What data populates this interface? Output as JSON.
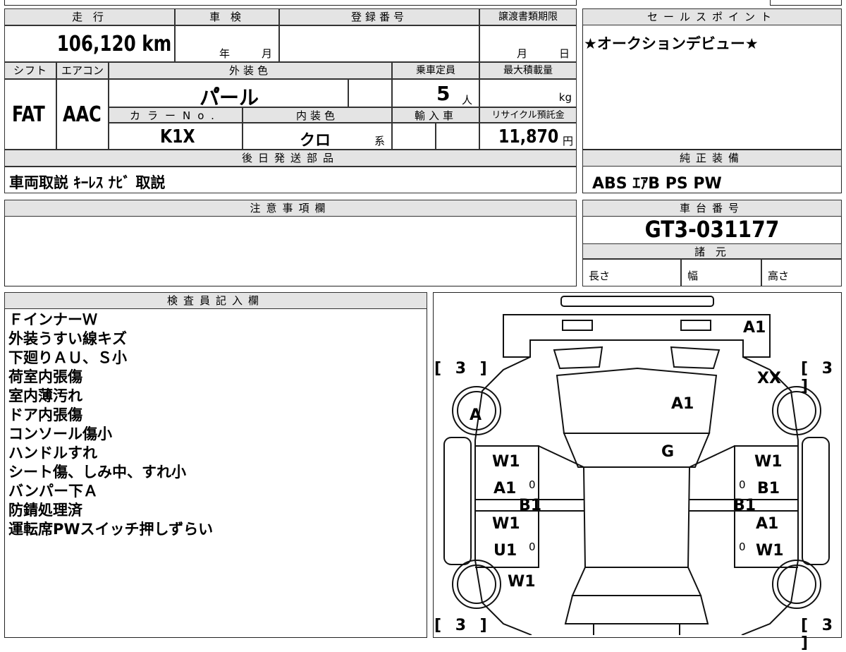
{
  "mileage": {
    "header": "走 行",
    "value": "106,120 km"
  },
  "inspection": {
    "header": "車 検",
    "year_unit": "年",
    "month_unit": "月"
  },
  "registration": {
    "header": "登録番号"
  },
  "transfer_deadline": {
    "header": "譲渡書類期限",
    "month_unit": "月",
    "day_unit": "日"
  },
  "sales_point": {
    "header": "セールスポイント",
    "text": "★オークションデビュー★"
  },
  "shift": {
    "header": "シフト",
    "value": "FAT"
  },
  "aircon": {
    "header": "エアコン",
    "value": "AAC"
  },
  "exterior_color": {
    "header": "外装色",
    "value": "パ゚ール"
  },
  "capacity": {
    "header": "乗車定員",
    "value": "5",
    "unit": "人"
  },
  "max_load": {
    "header": "最大積載量",
    "unit": "kg"
  },
  "color_no": {
    "header": "カラーNo.",
    "value": "K1X"
  },
  "interior_color": {
    "header": "内装色",
    "value": "クロ",
    "suffix": "系"
  },
  "import": {
    "header": "輸入車"
  },
  "recycle_fee": {
    "header": "リサイクル預託金",
    "value": "11,870",
    "unit": "円"
  },
  "later_parts": {
    "header": "後日発送部品",
    "text": "車両取説 ｷｰﾚｽ ﾅﾋﾞ 取説"
  },
  "genuine_equipment": {
    "header": "純正装備",
    "text": "ABS ｴｱB PS PW"
  },
  "notes": {
    "header": "注意事項欄"
  },
  "chassis": {
    "header": "車台番号",
    "value": "GT3-031177"
  },
  "specs": {
    "header": "諸 元",
    "length": "長さ",
    "width": "幅",
    "height": "高さ"
  },
  "inspector": {
    "header": "検査員記入欄",
    "lines": [
      "ＦインナーＷ",
      "外装うすい線キズ",
      "下廻りＡＵ、Ｓ小",
      "荷室内張傷",
      "室内薄汚れ",
      "ドア内張傷",
      "コンソール傷小",
      "ハンドルすれ",
      "シート傷、しみ中、すれ小",
      "バンパー下Ａ",
      "防錆処理済",
      "運転席PWスイッチ押しずらい"
    ]
  },
  "diagram": {
    "marks": {
      "front_bumper": "A1",
      "front_right": "XX",
      "hood": "A1",
      "windshield": "G",
      "left_wheel_front": "A",
      "l_fender_top": "W1",
      "l_fender_mid": "A1",
      "l_sill": "B1",
      "l_rdoor_top": "W1",
      "l_rdoor_mid": "U1",
      "l_rear": "W1",
      "r_fender_top": "W1",
      "r_fender_mid": "B1",
      "r_sill": "B1",
      "r_rdoor_top": "A1",
      "r_rdoor_mid": "W1",
      "small_0": "0"
    },
    "tire_marks": {
      "tl": "[ 3 ]",
      "tr": "[ 3 ]",
      "bl": "[ 3 ]",
      "br": "[ 3 ]"
    }
  }
}
